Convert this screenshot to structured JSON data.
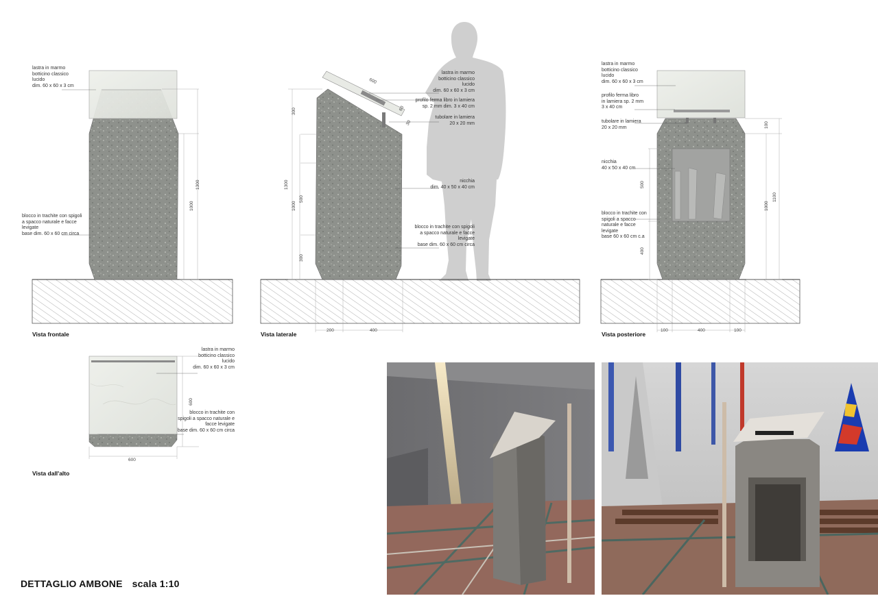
{
  "title": {
    "main": "DETTAGLIO AMBONE",
    "scale": "scala 1:10"
  },
  "views": {
    "front": {
      "caption": "Vista frontale"
    },
    "side": {
      "caption": "Vista laterale"
    },
    "rear": {
      "caption": "Vista posteriore"
    },
    "top": {
      "caption": "Vista dall'alto"
    }
  },
  "notes": {
    "front_slab": "lastra in marmo\nbotticino classico\nlucido\ndim. 60 x 60 x 3 cm",
    "front_block": "blocco in trachite con spigoli\na spacco naturale e facce\nlevigate\nbase dim. 60 x 60 cm circa",
    "side_slab": "lastra in marmo\nbotticino classico\nlucido\ndim. 60 x 60 x 3 cm",
    "side_profile": "profilo ferma libro in lamiera\nsp. 2 mm  dim. 3 x 40 cm",
    "side_tube": "tubolare in lamiera\n20 x 20 mm",
    "side_niche": "nicchia\ndim. 40 x 50 x 40 cm",
    "side_block": "blocco in trachite con spigoli\na spacco naturale e facce\nlevigate\nbase dim. 60 x 60 cm circa",
    "rear_slab": "lastra in marmo\nbotticino classico\nlucido\ndim. 60 x 60 x 3 cm",
    "rear_profile": "profilo ferma libro\nin lamiera sp. 2 mm\n3 x 40 cm",
    "rear_tube": "tubolare in lamiera\n20 x 20 mm",
    "rear_niche": "nicchia\n40 x 50 x 40 cm",
    "rear_block": "blocco in trachite con\nspigoli a spacco\nnaturale e facce\nlevigate\nbase 60 x 60 cm c.a",
    "top_slab": "lastra in marmo\nbotticino classico\nlucido\ndim. 60 x 60 x 3 cm",
    "top_block": "blocco in trachite con\nspigoli a spacco naturale e\nfacce levigate\nbase dim. 60 x 60 cm circa"
  },
  "dimensions": {
    "front_1300": "1300",
    "front_1000": "1000",
    "side_600": "600",
    "side_60": "60",
    "side_30": "30",
    "side_left_300a": "300",
    "side_left_1300": "1300",
    "side_left_1000": "1000",
    "side_left_500": "500",
    "side_left_300b": "300",
    "side_bottom_200": "200",
    "side_bottom_400": "400",
    "rear_100": "100",
    "rear_500": "500",
    "rear_400": "400",
    "rear_1000": "1000",
    "rear_1100": "1100",
    "rear_bottom_100a": "100",
    "rear_bottom_400": "400",
    "rear_bottom_100b": "100",
    "top_600v": "600",
    "top_600h": "600"
  },
  "colors": {
    "stone": "#8c8f8b",
    "marble": "#e9ebe6",
    "hatch": "#666666",
    "silhouette": "#cfcfcf"
  }
}
